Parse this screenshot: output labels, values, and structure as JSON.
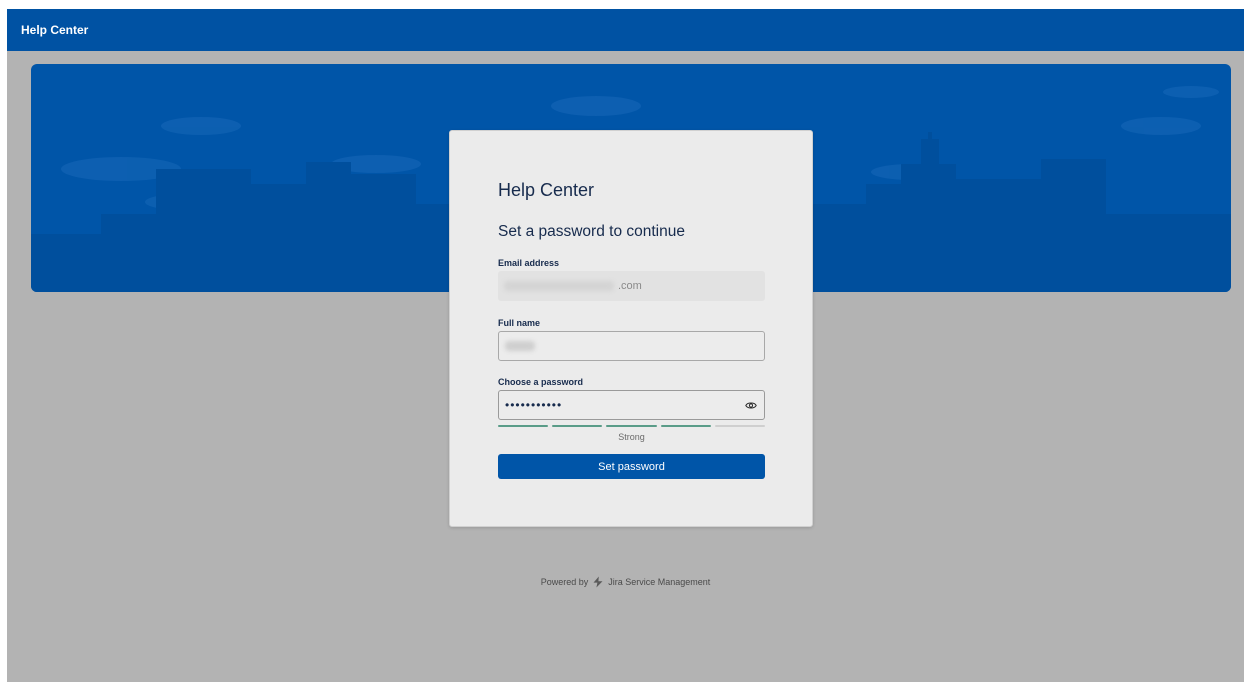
{
  "header": {
    "title": "Help Center"
  },
  "card": {
    "title": "Help Center",
    "heading": "Set a password to continue",
    "email": {
      "label": "Email address",
      "value_suffix": ".com"
    },
    "full_name": {
      "label": "Full name"
    },
    "password": {
      "label": "Choose a password",
      "masked_value": "•••••••••••",
      "strength_label": "Strong",
      "strength_level": 4,
      "strength_max": 5,
      "toggle_icon": "eye-icon"
    },
    "submit_label": "Set password"
  },
  "footer": {
    "prefix": "Powered by",
    "brand": "Jira Service Management",
    "brand_icon": "jira-bolt-icon"
  },
  "colors": {
    "topbar": "#0052a3",
    "banner": "#0055a8",
    "primary_button": "#0055a8",
    "strength_filled": "#5a9c88",
    "strength_empty": "#cfcfcf"
  }
}
